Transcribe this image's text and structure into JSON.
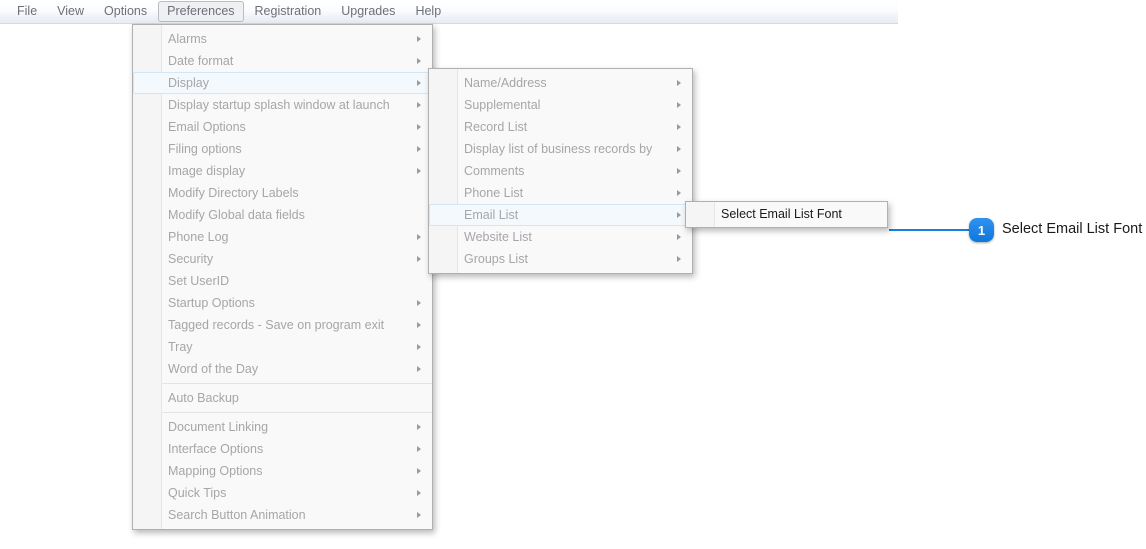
{
  "menubar": {
    "items": [
      {
        "label": "File",
        "active": false
      },
      {
        "label": "View",
        "active": false
      },
      {
        "label": "Options",
        "active": false
      },
      {
        "label": "Preferences",
        "active": true
      },
      {
        "label": "Registration",
        "active": false
      },
      {
        "label": "Upgrades",
        "active": false
      },
      {
        "label": "Help",
        "active": false
      }
    ]
  },
  "menus": {
    "preferences": {
      "items": [
        {
          "label": "Alarms",
          "arrow": true,
          "selected": false,
          "separator_after": false
        },
        {
          "label": "Date format",
          "arrow": true,
          "selected": false,
          "separator_after": false
        },
        {
          "label": "Display",
          "arrow": true,
          "selected": true,
          "separator_after": false
        },
        {
          "label": "Display startup splash window at launch",
          "arrow": true,
          "selected": false,
          "separator_after": false
        },
        {
          "label": "Email Options",
          "arrow": true,
          "selected": false,
          "separator_after": false
        },
        {
          "label": "Filing options",
          "arrow": true,
          "selected": false,
          "separator_after": false
        },
        {
          "label": "Image display",
          "arrow": true,
          "selected": false,
          "separator_after": false
        },
        {
          "label": "Modify Directory Labels",
          "arrow": false,
          "selected": false,
          "separator_after": false
        },
        {
          "label": "Modify Global data fields",
          "arrow": false,
          "selected": false,
          "separator_after": false
        },
        {
          "label": "Phone Log",
          "arrow": true,
          "selected": false,
          "separator_after": false
        },
        {
          "label": "Security",
          "arrow": true,
          "selected": false,
          "separator_after": false
        },
        {
          "label": "Set UserID",
          "arrow": false,
          "selected": false,
          "separator_after": false
        },
        {
          "label": "Startup Options",
          "arrow": true,
          "selected": false,
          "separator_after": false
        },
        {
          "label": "Tagged records - Save on program exit",
          "arrow": true,
          "selected": false,
          "separator_after": false
        },
        {
          "label": "Tray",
          "arrow": true,
          "selected": false,
          "separator_after": false
        },
        {
          "label": "Word of the Day",
          "arrow": true,
          "selected": false,
          "separator_after": true
        },
        {
          "label": "Auto Backup",
          "arrow": false,
          "selected": false,
          "separator_after": true
        },
        {
          "label": "Document Linking",
          "arrow": true,
          "selected": false,
          "separator_after": false
        },
        {
          "label": "Interface Options",
          "arrow": true,
          "selected": false,
          "separator_after": false
        },
        {
          "label": "Mapping Options",
          "arrow": true,
          "selected": false,
          "separator_after": false
        },
        {
          "label": "Quick Tips",
          "arrow": true,
          "selected": false,
          "separator_after": false
        },
        {
          "label": "Search Button Animation",
          "arrow": true,
          "selected": false,
          "separator_after": false
        }
      ]
    },
    "display": {
      "items": [
        {
          "label": "Name/Address",
          "arrow": true,
          "selected": false,
          "separator_after": false
        },
        {
          "label": "Supplemental",
          "arrow": true,
          "selected": false,
          "separator_after": false
        },
        {
          "label": "Record List",
          "arrow": true,
          "selected": false,
          "separator_after": false
        },
        {
          "label": "Display list of business records by",
          "arrow": true,
          "selected": false,
          "separator_after": false
        },
        {
          "label": "Comments",
          "arrow": true,
          "selected": false,
          "separator_after": false
        },
        {
          "label": "Phone List",
          "arrow": true,
          "selected": false,
          "separator_after": false
        },
        {
          "label": "Email List",
          "arrow": true,
          "selected": true,
          "separator_after": false
        },
        {
          "label": "Website List",
          "arrow": true,
          "selected": false,
          "separator_after": false
        },
        {
          "label": "Groups List",
          "arrow": true,
          "selected": false,
          "separator_after": false
        }
      ]
    },
    "email_list": {
      "items": [
        {
          "label": "Select Email List Font",
          "arrow": false,
          "selected": false,
          "dark": true,
          "separator_after": false
        }
      ]
    }
  },
  "callout": {
    "number": "1",
    "label": "Select Email List Font",
    "accent_color": "#1a7fe0"
  }
}
